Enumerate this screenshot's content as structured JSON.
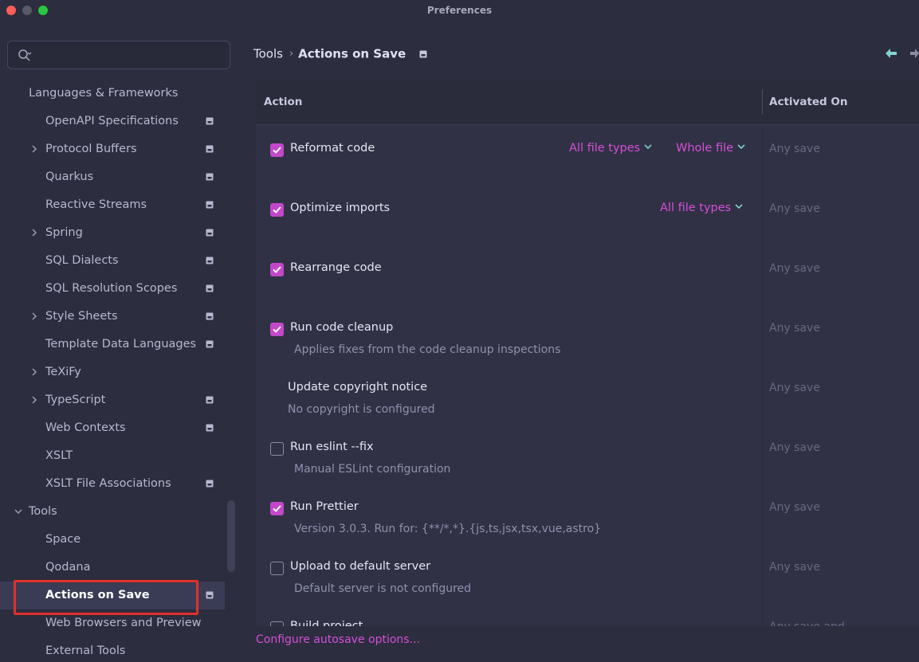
{
  "window": {
    "title": "Preferences"
  },
  "search": {
    "placeholder": "",
    "value": ""
  },
  "sidebar": {
    "items": [
      {
        "label": "Languages & Frameworks",
        "level": 0,
        "expanded": true,
        "has_icon": false
      },
      {
        "label": "OpenAPI Specifications",
        "level": 1,
        "has_children": false,
        "has_icon": true
      },
      {
        "label": "Protocol Buffers",
        "level": 1,
        "has_children": true,
        "has_icon": true
      },
      {
        "label": "Quarkus",
        "level": 1,
        "has_children": false,
        "has_icon": true
      },
      {
        "label": "Reactive Streams",
        "level": 1,
        "has_children": false,
        "has_icon": true
      },
      {
        "label": "Spring",
        "level": 1,
        "has_children": true,
        "has_icon": true
      },
      {
        "label": "SQL Dialects",
        "level": 1,
        "has_children": false,
        "has_icon": true
      },
      {
        "label": "SQL Resolution Scopes",
        "level": 1,
        "has_children": false,
        "has_icon": true
      },
      {
        "label": "Style Sheets",
        "level": 1,
        "has_children": true,
        "has_icon": true
      },
      {
        "label": "Template Data Languages",
        "level": 1,
        "has_children": false,
        "has_icon": true
      },
      {
        "label": "TeXiFy",
        "level": 1,
        "has_children": true,
        "has_icon": false
      },
      {
        "label": "TypeScript",
        "level": 1,
        "has_children": true,
        "has_icon": true
      },
      {
        "label": "Web Contexts",
        "level": 1,
        "has_children": false,
        "has_icon": true
      },
      {
        "label": "XSLT",
        "level": 1,
        "has_children": false,
        "has_icon": false
      },
      {
        "label": "XSLT File Associations",
        "level": 1,
        "has_children": false,
        "has_icon": true
      },
      {
        "label": "Tools",
        "level": 0,
        "expanded": true,
        "has_icon": false
      },
      {
        "label": "Space",
        "level": 1,
        "has_children": false,
        "has_icon": false
      },
      {
        "label": "Qodana",
        "level": 1,
        "has_children": false,
        "has_icon": false
      },
      {
        "label": "Actions on Save",
        "level": 1,
        "has_children": false,
        "has_icon": true,
        "selected": true
      },
      {
        "label": "Web Browsers and Preview",
        "level": 1,
        "has_children": false,
        "has_icon": false
      },
      {
        "label": "External Tools",
        "level": 1,
        "has_children": false,
        "has_icon": false
      }
    ]
  },
  "breadcrumb": {
    "parent": "Tools",
    "current": "Actions on Save"
  },
  "table": {
    "header_action": "Action",
    "header_activated": "Activated On",
    "rows": [
      {
        "title": "Reformat code",
        "subtitle": "",
        "checkbox": "checked",
        "activated": "Any save",
        "dropdowns": [
          "All file types",
          "Whole file"
        ]
      },
      {
        "title": "Optimize imports",
        "subtitle": "",
        "checkbox": "checked",
        "activated": "Any save",
        "dropdowns": [
          "All file types"
        ]
      },
      {
        "title": "Rearrange code",
        "subtitle": "",
        "checkbox": "checked",
        "activated": "Any save",
        "dropdowns": []
      },
      {
        "title": "Run code cleanup",
        "subtitle": "Applies fixes from the code cleanup inspections",
        "checkbox": "checked",
        "activated": "Any save",
        "dropdowns": []
      },
      {
        "title": "Update copyright notice",
        "subtitle": "No copyright is configured",
        "checkbox": "none",
        "activated": "Any save",
        "dropdowns": []
      },
      {
        "title": "Run eslint --fix",
        "subtitle": "Manual ESLint configuration",
        "checkbox": "unchecked",
        "activated": "Any save",
        "dropdowns": []
      },
      {
        "title": "Run Prettier",
        "subtitle": "Version 3.0.3. Run for: {**/*,*}.{js,ts,jsx,tsx,vue,astro}",
        "checkbox": "checked",
        "activated": "Any save",
        "dropdowns": []
      },
      {
        "title": "Upload to default server",
        "subtitle": "Default server is not configured",
        "checkbox": "unchecked",
        "activated": "Any save",
        "dropdowns": []
      },
      {
        "title": "Build project",
        "subtitle": "",
        "checkbox": "unchecked",
        "activated": "Any save and",
        "dropdowns": []
      }
    ]
  },
  "footer": {
    "configure_link": "Configure autosave options..."
  },
  "colors": {
    "background": "#2c2d3e",
    "accent": "#d44fd8",
    "checkbox": "#c248c9",
    "selection": "#3a3c55",
    "highlight_box": "#e0312a",
    "back_arrow": "#7fd3d0"
  },
  "icons": {
    "search": "search-icon",
    "project": "project-scope-icon",
    "back": "back-arrow-icon",
    "forward": "forward-arrow-icon"
  }
}
